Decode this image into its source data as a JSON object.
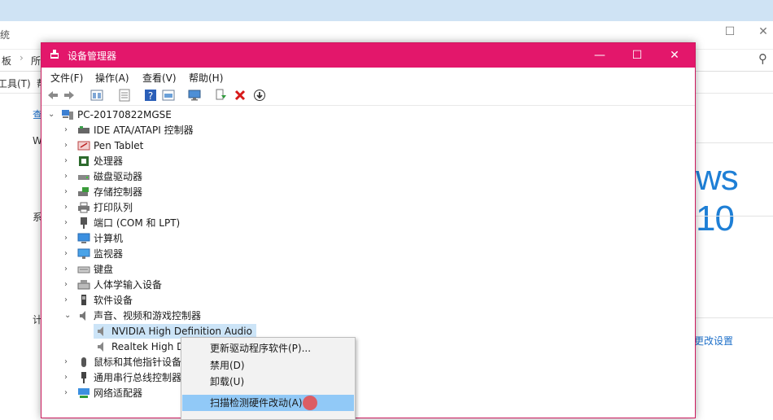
{
  "background_window": {
    "title_fragment": "统",
    "address_fragment_1": "板",
    "address_fragment_2": "所",
    "menu_fragment_1": "工具(T)",
    "menu_fragment_2": "帮",
    "left_link_fragment": "查",
    "left_text_fragment_1": "W",
    "left_text_fragment_2": "系",
    "left_text_fragment_3": "计",
    "windows_logo_text": "ws 10",
    "change_settings_link": "更改设置",
    "search_icon_glyph": "⚲"
  },
  "device_manager": {
    "title": "设备管理器",
    "window_controls": {
      "minimize": "—",
      "maximize": "☐",
      "close": "✕"
    },
    "menu": [
      "文件(F)",
      "操作(A)",
      "查看(V)",
      "帮助(H)"
    ],
    "tree": {
      "root": "PC-20170822MGSE",
      "items": [
        {
          "label": "IDE ATA/ATAPI 控制器",
          "icon": "ide-controller-icon"
        },
        {
          "label": "Pen Tablet",
          "icon": "pen-tablet-icon"
        },
        {
          "label": "处理器",
          "icon": "processor-icon"
        },
        {
          "label": "磁盘驱动器",
          "icon": "disk-drive-icon"
        },
        {
          "label": "存储控制器",
          "icon": "storage-controller-icon"
        },
        {
          "label": "打印队列",
          "icon": "printer-icon"
        },
        {
          "label": "端口 (COM 和 LPT)",
          "icon": "port-icon"
        },
        {
          "label": "计算机",
          "icon": "computer-icon"
        },
        {
          "label": "监视器",
          "icon": "monitor-icon"
        },
        {
          "label": "键盘",
          "icon": "keyboard-icon"
        },
        {
          "label": "人体学输入设备",
          "icon": "hid-icon"
        },
        {
          "label": "软件设备",
          "icon": "software-device-icon"
        },
        {
          "label": "声音、视频和游戏控制器",
          "icon": "sound-icon"
        }
      ],
      "sound_children": [
        "NVIDIA High Definition Audio",
        "Realtek High Definition Audio"
      ],
      "after_items": [
        {
          "label": "鼠标和其他指针设备",
          "icon": "mouse-icon"
        },
        {
          "label": "通用串行总线控制器",
          "icon": "usb-icon"
        },
        {
          "label": "网络适配器",
          "icon": "network-icon"
        }
      ]
    }
  },
  "context_menu": {
    "items": [
      "更新驱动程序软件(P)...",
      "禁用(D)",
      "卸载(U)",
      "扫描检测硬件改动(A)"
    ]
  }
}
